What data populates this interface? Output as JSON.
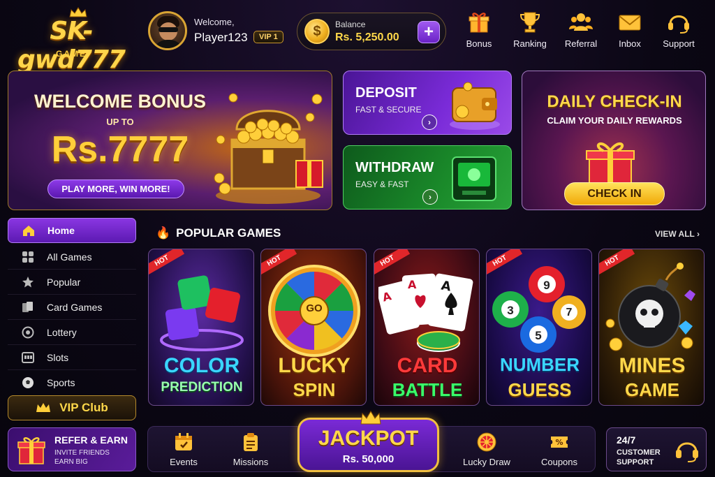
{
  "brand": {
    "logo_text": "SK-gwd777",
    "logo_sub": "GAME"
  },
  "user": {
    "welcome": "Welcome,",
    "name": "Player123",
    "vip": "VIP 1"
  },
  "balance": {
    "label": "Balance",
    "value": "Rs. 5,250.00",
    "add": "+"
  },
  "topnav": [
    {
      "label": "Bonus",
      "icon": "gift-icon"
    },
    {
      "label": "Ranking",
      "icon": "trophy-icon"
    },
    {
      "label": "Referral",
      "icon": "users-icon"
    },
    {
      "label": "Inbox",
      "icon": "mail-icon"
    },
    {
      "label": "Support",
      "icon": "headset-icon"
    }
  ],
  "welcome_banner": {
    "title": "WELCOME BONUS",
    "upto": "UP TO",
    "amount": "Rs.7777",
    "button": "PLAY MORE, WIN MORE!"
  },
  "deposit": {
    "title": "DEPOSIT",
    "subtitle": "FAST & SECURE",
    "arrow": "›"
  },
  "withdraw": {
    "title": "WITHDRAW",
    "subtitle": "EASY & FAST",
    "arrow": "›"
  },
  "checkin": {
    "title": "DAILY CHECK-IN",
    "subtitle": "CLAIM YOUR DAILY REWARDS",
    "button": "CHECK IN"
  },
  "sidebar": {
    "items": [
      {
        "label": "Home",
        "icon": "home-icon"
      },
      {
        "label": "All Games",
        "icon": "grid-icon"
      },
      {
        "label": "Popular",
        "icon": "star-icon"
      },
      {
        "label": "Card Games",
        "icon": "cards-icon"
      },
      {
        "label": "Lottery",
        "icon": "lottery-icon"
      },
      {
        "label": "Slots",
        "icon": "slots-icon"
      },
      {
        "label": "Sports",
        "icon": "ball-icon"
      }
    ],
    "vip_club": "VIP Club"
  },
  "popular": {
    "title": "POPULAR GAMES",
    "view_all": "VIEW ALL",
    "hot_label": "HOT",
    "games": [
      {
        "line1": "COLOR",
        "line2": "PREDICTION"
      },
      {
        "line1": "LUCKY",
        "line2": "SPIN",
        "center": "GO"
      },
      {
        "line1": "CARD",
        "line2": "BATTLE"
      },
      {
        "line1": "NUMBER",
        "line2": "GUESS",
        "balls": [
          "9",
          "3",
          "7",
          "5"
        ]
      },
      {
        "line1": "MINES",
        "line2": "GAME"
      }
    ]
  },
  "refer": {
    "title": "REFER & EARN",
    "line1": "INVITE FRIENDS",
    "line2": "EARN BIG"
  },
  "bottom_nav": [
    {
      "label": "Events",
      "icon": "calendar-icon"
    },
    {
      "label": "Missions",
      "icon": "clipboard-icon"
    },
    {
      "label": "Lucky Draw",
      "icon": "wheel-icon"
    },
    {
      "label": "Coupons",
      "icon": "coupon-icon"
    }
  ],
  "jackpot": {
    "title": "JACKPOT",
    "value": "Rs. 50,000"
  },
  "support": {
    "line1": "24/7",
    "line2": "CUSTOMER",
    "line3": "SUPPORT"
  },
  "colors": {
    "gold": "#ffd84a",
    "purple": "#7a2ad6",
    "green": "#1a8a2a",
    "hot_red": "#e1262a"
  }
}
